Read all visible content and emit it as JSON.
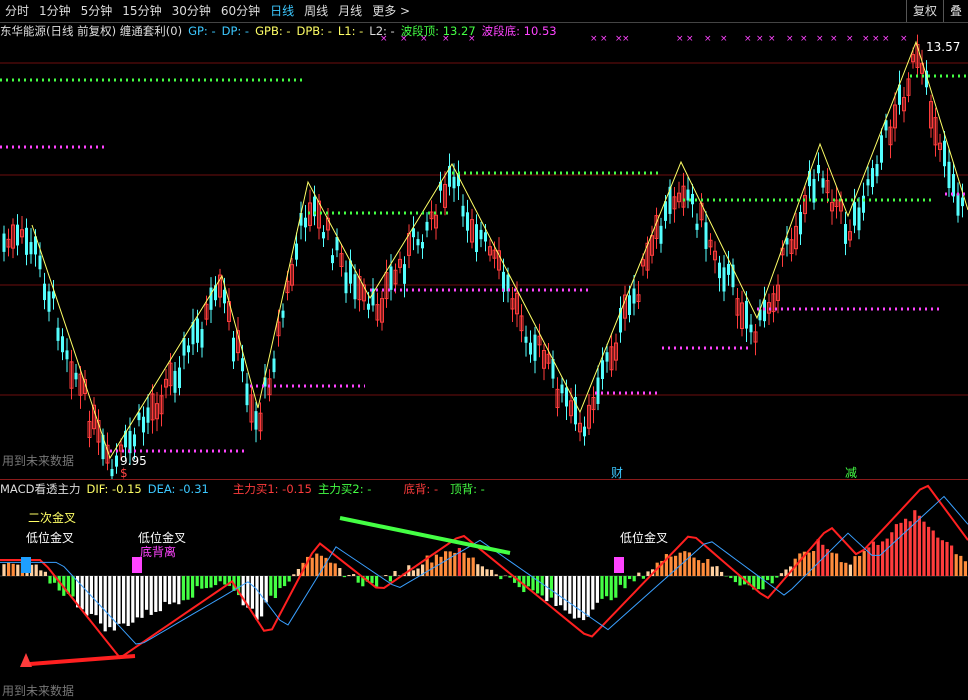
{
  "toolbar": {
    "periods": [
      "分时",
      "1分钟",
      "5分钟",
      "15分钟",
      "30分钟",
      "60分钟",
      "日线",
      "周线",
      "月线",
      "更多 >"
    ],
    "active_index": 6,
    "right_buttons": [
      "复权",
      "叠"
    ]
  },
  "price_legend": {
    "title": "东华能源(日线 前复权) 缠通套利(0)",
    "gp": "GP: -",
    "dp": "DP: -",
    "gpb": "GPB: -",
    "dpb": "DPB: -",
    "l1": "L1: -",
    "l2": "L2: -",
    "wave_top": "波段顶: 13.27",
    "wave_bottom": "波段底: 10.53"
  },
  "price_annotations": {
    "high_label": "13.57",
    "low_label": "9.95",
    "watermark": "用到未来数据",
    "events": [
      "$",
      "财",
      "减"
    ]
  },
  "macd_legend": {
    "title": "MACD看透主力",
    "dif": "DIF: -0.15",
    "dea": "DEA: -0.31",
    "buy1": "主力买1: -0.15",
    "buy2": "主力买2: -",
    "bottom_div": "底背: -",
    "top_div": "顶背: -"
  },
  "macd_annotations": {
    "second_cross": "二次金叉",
    "low_cross_1": "低位金叉",
    "low_cross_2": "低位金叉",
    "bottom_div_label": "底背离",
    "low_cross_3": "低位金叉",
    "watermark": "用到未来数据"
  },
  "colors": {
    "up": "#ff3c3c",
    "down": "#54ffff",
    "zigzag": "#ffff66",
    "top_dots": "#44ff44",
    "bottom_dots": "#ff44ff",
    "dif": "#ff2020",
    "dea": "#3aa0ff",
    "legend_cyan": "#3cc8ff",
    "legend_yellow": "#ffff66",
    "legend_green": "#44ff44",
    "legend_magenta": "#ff44ff"
  },
  "chart_data": {
    "type": "candlestick",
    "price_high": 13.57,
    "price_low": 9.95,
    "wave_top": 13.27,
    "wave_bottom": 10.53
  }
}
